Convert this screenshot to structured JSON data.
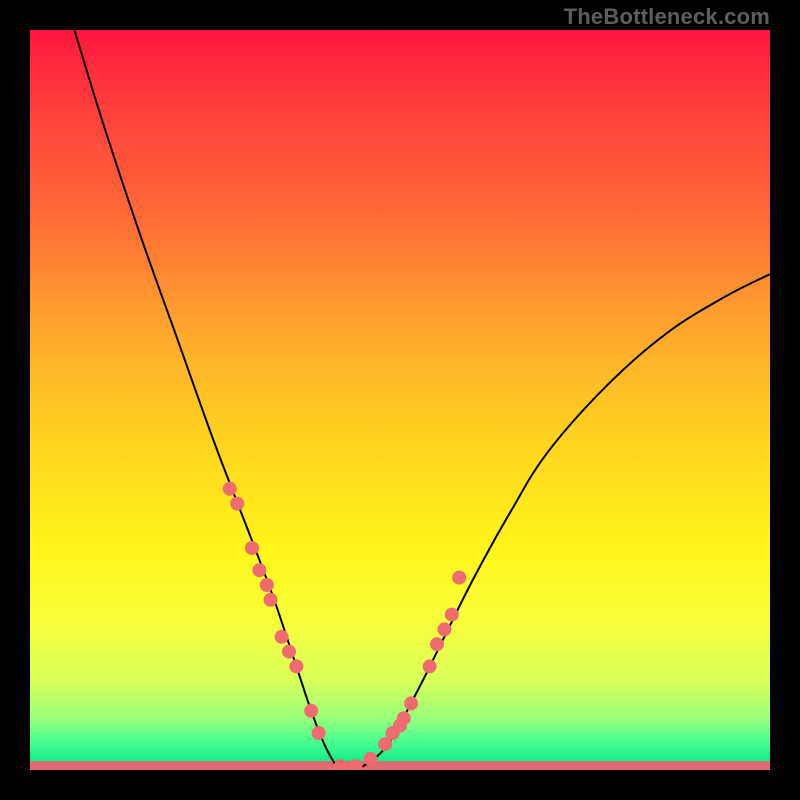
{
  "attribution": "TheBottleneck.com",
  "chart_data": {
    "type": "line",
    "title": "",
    "xlabel": "",
    "ylabel": "",
    "xlim": [
      0,
      100
    ],
    "ylim": [
      0,
      100
    ],
    "series": [
      {
        "name": "bottleneck-curve",
        "x": [
          6,
          10,
          15,
          20,
          25,
          30,
          33,
          36,
          38,
          40,
          42,
          44,
          48,
          52,
          56,
          60,
          65,
          70,
          78,
          86,
          94,
          100
        ],
        "y": [
          100,
          87,
          72,
          58,
          44,
          31,
          23,
          14,
          8,
          3,
          0,
          0,
          3,
          10,
          18,
          26,
          35,
          43,
          52,
          59,
          64,
          67
        ]
      }
    ],
    "markers": {
      "name": "sample-points",
      "x": [
        27,
        28,
        30,
        31,
        32,
        32.5,
        34,
        35,
        36,
        38,
        39,
        42,
        44,
        46,
        48,
        49,
        50,
        50.5,
        51.5,
        54,
        55,
        56,
        57,
        58
      ],
      "y": [
        38,
        36,
        30,
        27,
        25,
        23,
        18,
        16,
        14,
        8,
        5,
        0.5,
        0.5,
        1.5,
        3.5,
        5,
        6,
        7,
        9,
        14,
        17,
        19,
        21,
        26
      ],
      "color": "#ee6b70",
      "radius": 7
    },
    "bottom_band": {
      "name": "baseline-band",
      "y": [
        0,
        1.2
      ],
      "color": "#e06a70"
    }
  }
}
